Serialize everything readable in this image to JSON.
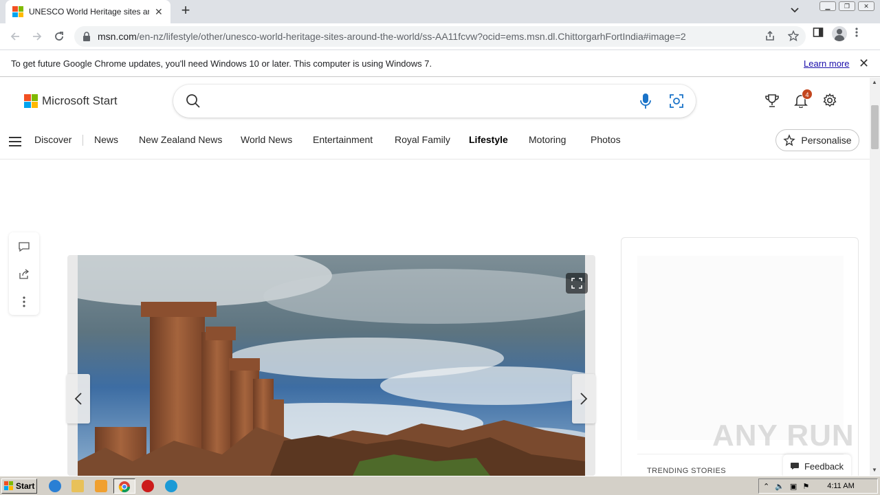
{
  "browser": {
    "tab_title": "UNESCO World Heritage sites around the world",
    "new_tab_symbol": "+",
    "tab_close_symbol": "✕",
    "url_domain": "msn.com",
    "url_path": "/en-nz/lifestyle/other/unesco-world-heritage-sites-around-the-world/ss-AA11fcvw?ocid=ems.msn.dl.ChittorgarhFortIndia#image=2",
    "icons": [
      "back-icon",
      "forward-icon",
      "reload-icon",
      "lock-icon",
      "share-icon",
      "star-icon",
      "side-panel-icon",
      "profile-icon",
      "menu-icon"
    ]
  },
  "infobar": {
    "message": "To get future Google Chrome updates, you'll need Windows 10 or later. This computer is using Windows 7.",
    "link": "Learn more",
    "close_symbol": "✕"
  },
  "header": {
    "brand": "Microsoft Start",
    "search_placeholder": "",
    "notification_count": "4",
    "logo_colors": [
      "#f25022",
      "#7fba00",
      "#00a4ef",
      "#ffb900"
    ]
  },
  "nav": {
    "items": [
      "Discover",
      "News",
      "New Zealand News",
      "World News",
      "Entertainment",
      "Royal Family",
      "Lifestyle",
      "Motoring",
      "Photos"
    ],
    "active": "Lifestyle",
    "personalise": "Personalise"
  },
  "sidebar": {
    "trending_label": "TRENDING STORIES"
  },
  "feedback": {
    "label": "Feedback"
  },
  "watermark": {
    "text": "ANY RUN"
  },
  "taskbar": {
    "start_label": "Start",
    "clock": "4:11 AM"
  }
}
